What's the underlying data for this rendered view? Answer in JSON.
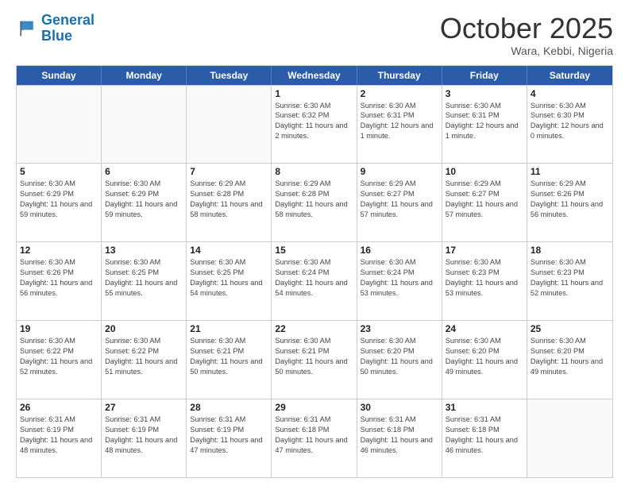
{
  "header": {
    "logo_general": "General",
    "logo_blue": "Blue",
    "month": "October 2025",
    "location": "Wara, Kebbi, Nigeria"
  },
  "weekdays": [
    "Sunday",
    "Monday",
    "Tuesday",
    "Wednesday",
    "Thursday",
    "Friday",
    "Saturday"
  ],
  "rows": [
    [
      {
        "day": "",
        "sunrise": "",
        "sunset": "",
        "daylight": ""
      },
      {
        "day": "",
        "sunrise": "",
        "sunset": "",
        "daylight": ""
      },
      {
        "day": "",
        "sunrise": "",
        "sunset": "",
        "daylight": ""
      },
      {
        "day": "1",
        "sunrise": "Sunrise: 6:30 AM",
        "sunset": "Sunset: 6:32 PM",
        "daylight": "Daylight: 11 hours and 2 minutes."
      },
      {
        "day": "2",
        "sunrise": "Sunrise: 6:30 AM",
        "sunset": "Sunset: 6:31 PM",
        "daylight": "Daylight: 12 hours and 1 minute."
      },
      {
        "day": "3",
        "sunrise": "Sunrise: 6:30 AM",
        "sunset": "Sunset: 6:31 PM",
        "daylight": "Daylight: 12 hours and 1 minute."
      },
      {
        "day": "4",
        "sunrise": "Sunrise: 6:30 AM",
        "sunset": "Sunset: 6:30 PM",
        "daylight": "Daylight: 12 hours and 0 minutes."
      }
    ],
    [
      {
        "day": "5",
        "sunrise": "Sunrise: 6:30 AM",
        "sunset": "Sunset: 6:29 PM",
        "daylight": "Daylight: 11 hours and 59 minutes."
      },
      {
        "day": "6",
        "sunrise": "Sunrise: 6:30 AM",
        "sunset": "Sunset: 6:29 PM",
        "daylight": "Daylight: 11 hours and 59 minutes."
      },
      {
        "day": "7",
        "sunrise": "Sunrise: 6:29 AM",
        "sunset": "Sunset: 6:28 PM",
        "daylight": "Daylight: 11 hours and 58 minutes."
      },
      {
        "day": "8",
        "sunrise": "Sunrise: 6:29 AM",
        "sunset": "Sunset: 6:28 PM",
        "daylight": "Daylight: 11 hours and 58 minutes."
      },
      {
        "day": "9",
        "sunrise": "Sunrise: 6:29 AM",
        "sunset": "Sunset: 6:27 PM",
        "daylight": "Daylight: 11 hours and 57 minutes."
      },
      {
        "day": "10",
        "sunrise": "Sunrise: 6:29 AM",
        "sunset": "Sunset: 6:27 PM",
        "daylight": "Daylight: 11 hours and 57 minutes."
      },
      {
        "day": "11",
        "sunrise": "Sunrise: 6:29 AM",
        "sunset": "Sunset: 6:26 PM",
        "daylight": "Daylight: 11 hours and 56 minutes."
      }
    ],
    [
      {
        "day": "12",
        "sunrise": "Sunrise: 6:30 AM",
        "sunset": "Sunset: 6:26 PM",
        "daylight": "Daylight: 11 hours and 56 minutes."
      },
      {
        "day": "13",
        "sunrise": "Sunrise: 6:30 AM",
        "sunset": "Sunset: 6:25 PM",
        "daylight": "Daylight: 11 hours and 55 minutes."
      },
      {
        "day": "14",
        "sunrise": "Sunrise: 6:30 AM",
        "sunset": "Sunset: 6:25 PM",
        "daylight": "Daylight: 11 hours and 54 minutes."
      },
      {
        "day": "15",
        "sunrise": "Sunrise: 6:30 AM",
        "sunset": "Sunset: 6:24 PM",
        "daylight": "Daylight: 11 hours and 54 minutes."
      },
      {
        "day": "16",
        "sunrise": "Sunrise: 6:30 AM",
        "sunset": "Sunset: 6:24 PM",
        "daylight": "Daylight: 11 hours and 53 minutes."
      },
      {
        "day": "17",
        "sunrise": "Sunrise: 6:30 AM",
        "sunset": "Sunset: 6:23 PM",
        "daylight": "Daylight: 11 hours and 53 minutes."
      },
      {
        "day": "18",
        "sunrise": "Sunrise: 6:30 AM",
        "sunset": "Sunset: 6:23 PM",
        "daylight": "Daylight: 11 hours and 52 minutes."
      }
    ],
    [
      {
        "day": "19",
        "sunrise": "Sunrise: 6:30 AM",
        "sunset": "Sunset: 6:22 PM",
        "daylight": "Daylight: 11 hours and 52 minutes."
      },
      {
        "day": "20",
        "sunrise": "Sunrise: 6:30 AM",
        "sunset": "Sunset: 6:22 PM",
        "daylight": "Daylight: 11 hours and 51 minutes."
      },
      {
        "day": "21",
        "sunrise": "Sunrise: 6:30 AM",
        "sunset": "Sunset: 6:21 PM",
        "daylight": "Daylight: 11 hours and 50 minutes."
      },
      {
        "day": "22",
        "sunrise": "Sunrise: 6:30 AM",
        "sunset": "Sunset: 6:21 PM",
        "daylight": "Daylight: 11 hours and 50 minutes."
      },
      {
        "day": "23",
        "sunrise": "Sunrise: 6:30 AM",
        "sunset": "Sunset: 6:20 PM",
        "daylight": "Daylight: 11 hours and 50 minutes."
      },
      {
        "day": "24",
        "sunrise": "Sunrise: 6:30 AM",
        "sunset": "Sunset: 6:20 PM",
        "daylight": "Daylight: 11 hours and 49 minutes."
      },
      {
        "day": "25",
        "sunrise": "Sunrise: 6:30 AM",
        "sunset": "Sunset: 6:20 PM",
        "daylight": "Daylight: 11 hours and 49 minutes."
      }
    ],
    [
      {
        "day": "26",
        "sunrise": "Sunrise: 6:31 AM",
        "sunset": "Sunset: 6:19 PM",
        "daylight": "Daylight: 11 hours and 48 minutes."
      },
      {
        "day": "27",
        "sunrise": "Sunrise: 6:31 AM",
        "sunset": "Sunset: 6:19 PM",
        "daylight": "Daylight: 11 hours and 48 minutes."
      },
      {
        "day": "28",
        "sunrise": "Sunrise: 6:31 AM",
        "sunset": "Sunset: 6:19 PM",
        "daylight": "Daylight: 11 hours and 47 minutes."
      },
      {
        "day": "29",
        "sunrise": "Sunrise: 6:31 AM",
        "sunset": "Sunset: 6:18 PM",
        "daylight": "Daylight: 11 hours and 47 minutes."
      },
      {
        "day": "30",
        "sunrise": "Sunrise: 6:31 AM",
        "sunset": "Sunset: 6:18 PM",
        "daylight": "Daylight: 11 hours and 46 minutes."
      },
      {
        "day": "31",
        "sunrise": "Sunrise: 6:31 AM",
        "sunset": "Sunset: 6:18 PM",
        "daylight": "Daylight: 11 hours and 46 minutes."
      },
      {
        "day": "",
        "sunrise": "",
        "sunset": "",
        "daylight": ""
      }
    ]
  ]
}
